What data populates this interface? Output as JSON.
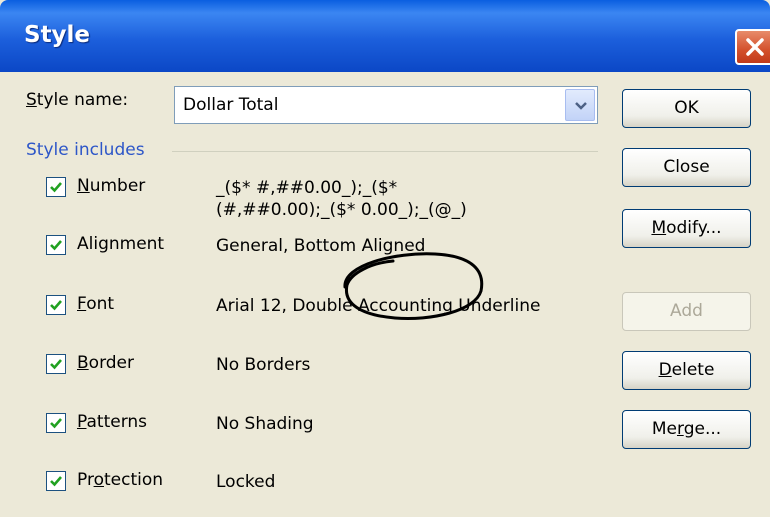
{
  "window": {
    "title": "Style"
  },
  "style_name": {
    "label": "Style name:",
    "accel": "S",
    "label_rest": "tyle name:",
    "value": "Dollar Total"
  },
  "group": {
    "label": "Style includes"
  },
  "items": [
    {
      "accel": "N",
      "rest": "umber",
      "checked": true,
      "desc_line1": "_($* #,##0.00_);_($*",
      "desc_line2": "(#,##0.00);_($* 0.00_);_(@_)"
    },
    {
      "accel": "",
      "rest": "Alignment",
      "checked": true,
      "desc": "General, Bottom Aligned"
    },
    {
      "accel": "F",
      "rest": "ont",
      "checked": true,
      "desc": "Arial 12, Double Accounting Underline"
    },
    {
      "accel": "B",
      "rest": "order",
      "checked": true,
      "desc": "No Borders"
    },
    {
      "accel": "P",
      "rest": "atterns",
      "checked": true,
      "desc": "No Shading"
    },
    {
      "pre": "Pr",
      "accel": "o",
      "rest": "tection",
      "checked": true,
      "desc": "Locked"
    }
  ],
  "buttons": {
    "ok": "OK",
    "close": "Close",
    "modify": {
      "accel": "M",
      "rest": "odify..."
    },
    "add": "Add",
    "delete": {
      "accel": "D",
      "rest": "elete"
    },
    "merge": {
      "pre": "Me",
      "accel": "r",
      "rest": "ge..."
    }
  },
  "colors": {
    "title_bar": "#1c5fdc",
    "dialog_bg": "#ece9d8",
    "group_label": "#2d56c8",
    "close_button": "#d3512c"
  },
  "icons": {
    "close": "close-x-icon",
    "dropdown": "chevron-down-icon",
    "check": "checkmark-icon"
  }
}
